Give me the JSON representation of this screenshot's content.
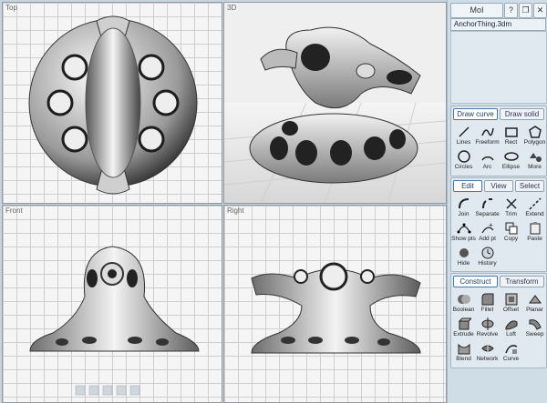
{
  "header": {
    "app_button": "MoI",
    "doc_title": "AnchorThing.3dm"
  },
  "viewports": [
    {
      "label": "Top"
    },
    {
      "label": "3D"
    },
    {
      "label": "Front"
    },
    {
      "label": "Right"
    }
  ],
  "draw_group": {
    "tabs": [
      "Draw curve",
      "Draw solid"
    ],
    "tools": [
      "Lines",
      "Freeform",
      "Rect",
      "Polygon",
      "Circles",
      "Arc",
      "Ellipse",
      "More"
    ]
  },
  "edit_group": {
    "tabs": [
      "Edit",
      "View",
      "Select"
    ],
    "tools": [
      "Join",
      "Separate",
      "Trim",
      "Extend",
      "Show pts",
      "Add pt",
      "Copy",
      "Paste",
      "Hide",
      "History"
    ]
  },
  "construct_group": {
    "tabs": [
      "Construct",
      "Transform"
    ],
    "tools": [
      "Boolean",
      "Fillet",
      "Offset",
      "Planar",
      "Extrude",
      "Revolve",
      "Loft",
      "Sweep",
      "Blend",
      "Network",
      "Curve"
    ]
  },
  "colors": {
    "panel_bg": "#cfdde6",
    "accent": "#4a78a6",
    "viewport_bg": "#f5f5f5"
  }
}
